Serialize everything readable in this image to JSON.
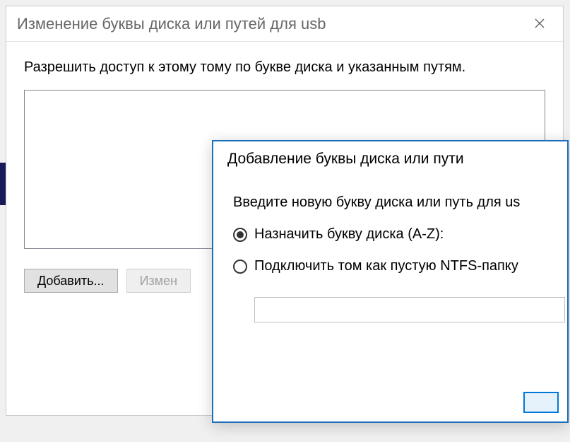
{
  "mainDialog": {
    "title": "Изменение буквы диска или путей для usb",
    "description": "Разрешить доступ к этому тому по букве диска и указанным путям.",
    "buttons": {
      "add": "Добавить...",
      "change": "Измен"
    }
  },
  "subDialog": {
    "title": "Добавление буквы диска или пути",
    "description": "Введите новую букву диска или путь для us",
    "radio1": "Назначить букву диска (A-Z):",
    "radio2": "Подключить том как пустую NTFS-папку",
    "pathValue": ""
  }
}
